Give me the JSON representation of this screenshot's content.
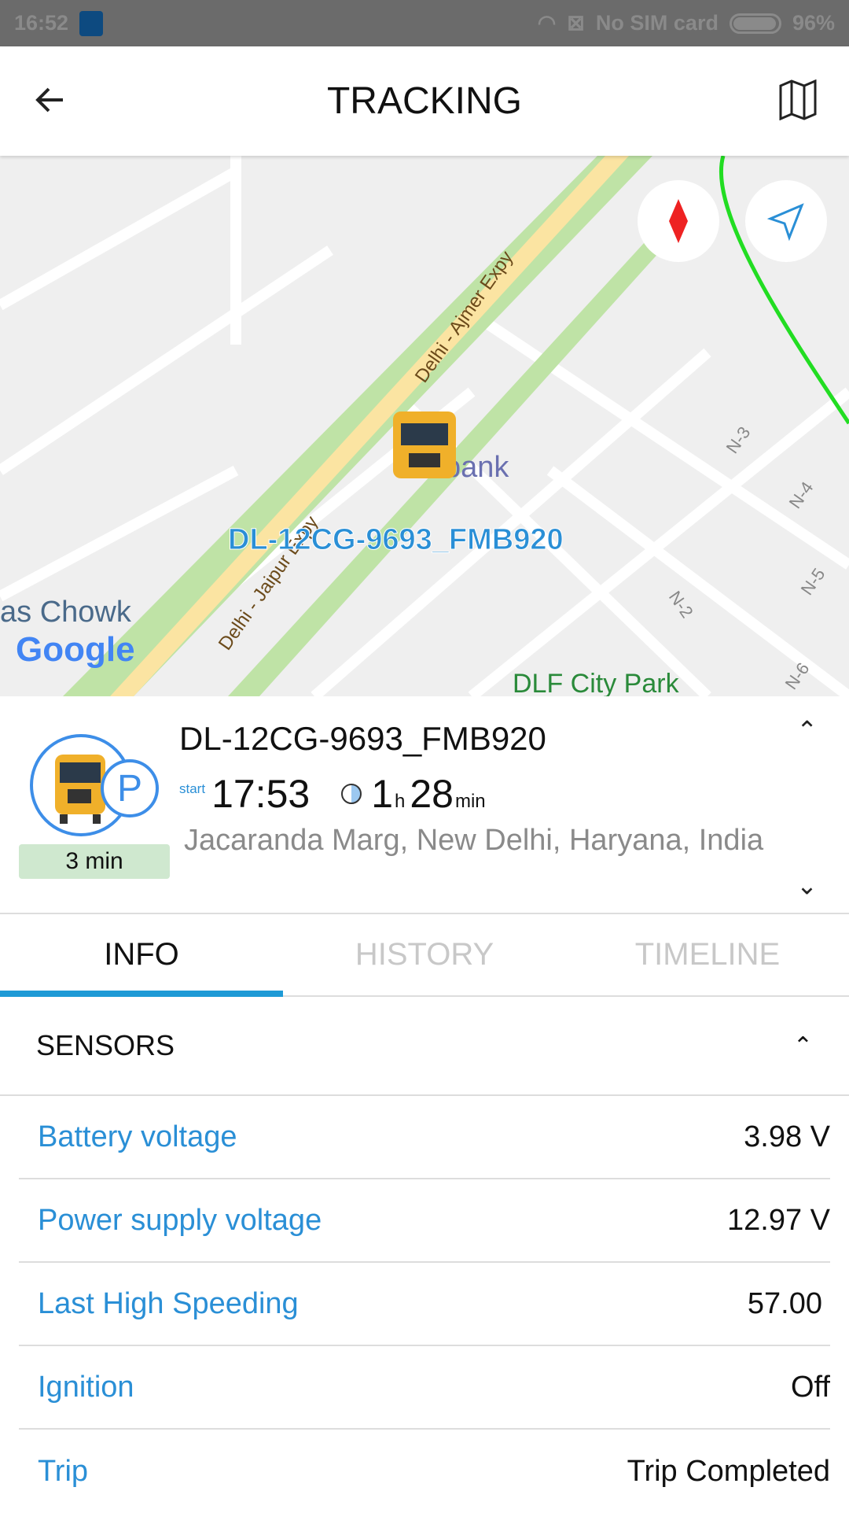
{
  "status_bar": {
    "time": "16:52",
    "sim": "No SIM card",
    "battery": "96%",
    "battery_level": 96
  },
  "app_bar": {
    "title": "TRACKING",
    "back_icon": "arrow-left-icon",
    "map_icon": "map-icon"
  },
  "map": {
    "labels": {
      "road1": "Delhi - Ajmer Expy",
      "road2": "Delhi - Jaipur Expy",
      "place1": "as Chowk",
      "place2": "bank",
      "park": "DLF City Park",
      "n2": "N-2",
      "n3": "N-3",
      "n4": "N-4",
      "n5": "N-5",
      "n6": "N-6",
      "vehicle": "DL-12CG-9693_FMB920",
      "google": "Google"
    },
    "route_color": "#22dd22"
  },
  "vehicle": {
    "name": "DL-12CG-9693_FMB920",
    "start_label": "start",
    "start_time": "17:53",
    "duration_h": "1",
    "h_unit": "h",
    "duration_min": "28",
    "min_unit": "min",
    "address": "Jacaranda Marg, New Delhi, Haryana, India",
    "status_icon": "parking-icon",
    "status_letter": "P",
    "idle": "3 min"
  },
  "tabs": [
    {
      "label": "INFO",
      "active": true
    },
    {
      "label": "HISTORY",
      "active": false
    },
    {
      "label": "TIMELINE",
      "active": false
    }
  ],
  "sensors": {
    "title": "SENSORS",
    "rows": [
      {
        "label": "Battery voltage",
        "value": "3.98 V"
      },
      {
        "label": "Power supply voltage",
        "value": "12.97 V"
      },
      {
        "label": "Last High Speeding",
        "value": "57.00"
      },
      {
        "label": "Ignition",
        "value": "Off"
      },
      {
        "label": "Trip",
        "value": "Trip Completed"
      }
    ]
  }
}
